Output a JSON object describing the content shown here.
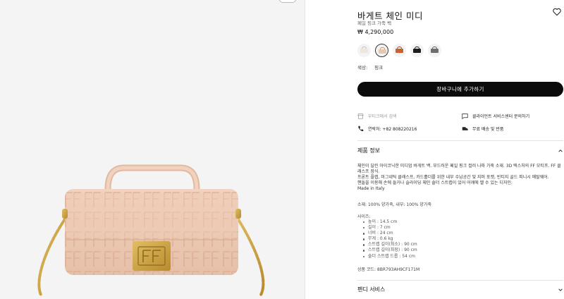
{
  "product": {
    "title": "바게트 체인 미디",
    "subtitle": "페일 핑크 가죽 백",
    "price": "₩ 4,290,000",
    "color_label": "색상:",
    "color_value": "핑크"
  },
  "swatches": [
    {
      "name": "white",
      "color": "#ece6dc",
      "selected": false
    },
    {
      "name": "pink",
      "color": "#e9c6b0",
      "selected": true
    },
    {
      "name": "orange",
      "color": "#c9622c",
      "selected": false
    },
    {
      "name": "black",
      "color": "#1c1c1c",
      "selected": false
    },
    {
      "name": "grey",
      "color": "#6e6e6e",
      "selected": false
    }
  ],
  "cart_button": "장바구니에 추가하기",
  "services": {
    "boutique": "부티크에서 검색",
    "client_service": "클라이언트 서비스센터 문의하기",
    "contact": "연락처: +82 808220216",
    "shipping": "무료 배송 및 반품"
  },
  "sections": {
    "info_title": "제품 정보",
    "fendi_service_title": "펜디 서비스"
  },
  "info": {
    "description": [
      "체인이 달린 아이코닉한 미디엄 바게트 백. 부드러운 페일 핑크 컬러 나파 가죽 소재. 3D 텍스처의 FF 모티프. FF 클래스프 장식.",
      "프론트 플랩, 마그네틱 클래스프, 카드홀더를 위한 내부 수납공간 및 지퍼 포켓, 빈티지 골드 피니시 메탈웨어.",
      "핸들을 이용해 손에 들거나 슬라이딩 체인 숄더 스트랩이 있어 어깨에 멜 수 있는 디자인.",
      "Made in Italy"
    ],
    "material": "소재: 100% 양가죽, 내부: 100% 양가죽",
    "size_header": "사이즈:",
    "sizes": [
      "높이 : 14.5 cm",
      "길이 : 7 cm",
      "너비 : 24 cm",
      "무게 : 0.6 kg",
      "스트랩 길이(최소) : 90 cm",
      "스트랩 길이(최장) : 90 cm",
      "숄더 스트랩 드롭 : 54 cm"
    ],
    "code": "상품 코드: 8BR793AH9CF171M"
  },
  "colors": {
    "accent_black": "#0b0b0b",
    "bag_leather": "#eecdb8",
    "hardware_gold": "#c89b3c"
  }
}
